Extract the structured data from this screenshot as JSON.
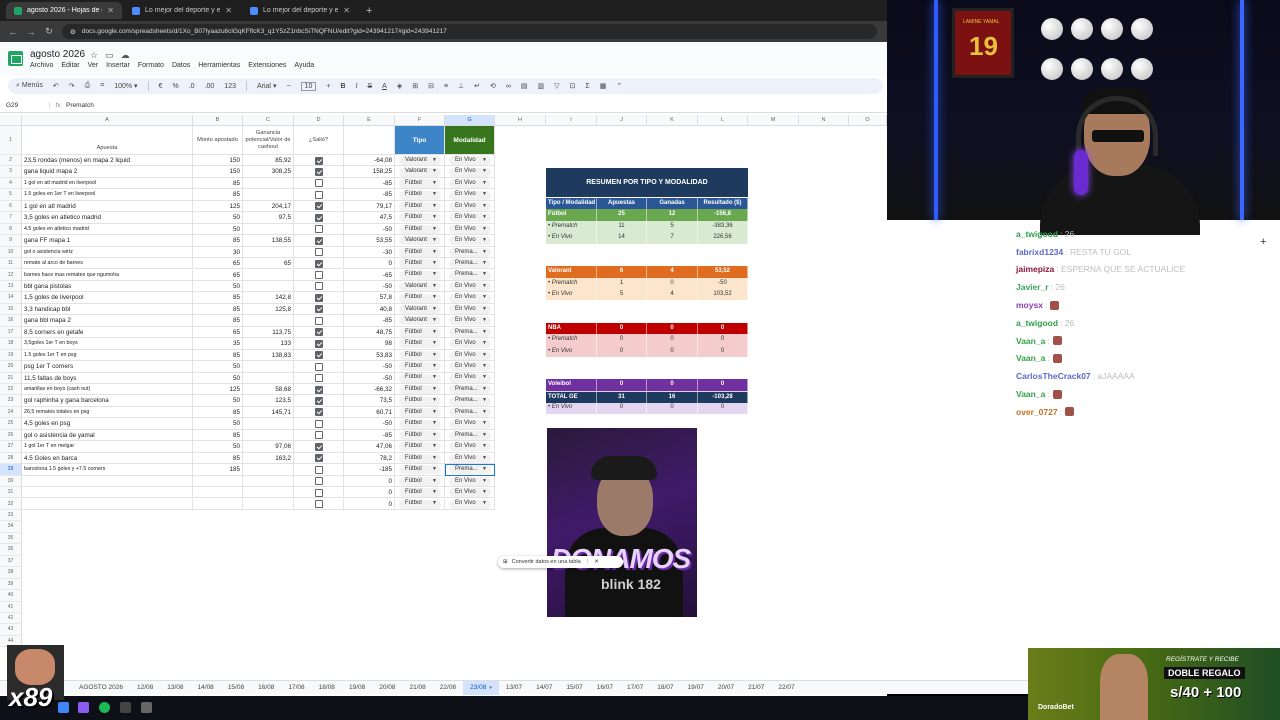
{
  "browser": {
    "tabs": [
      {
        "title": "agosto 2026 - Hojas de cálculo",
        "active": true,
        "favcolor": "#1fa463"
      },
      {
        "title": "Lo mejor del deporte y el entr",
        "active": false,
        "favcolor": "#4c8dff"
      },
      {
        "title": "Lo mejor del deporte y el entr",
        "active": false,
        "favcolor": "#4c8dff"
      }
    ],
    "new_tab": "+",
    "url": "docs.google.com/spreadsheets/d/1Xo_B07lyaazu6clGqKFflcK3_q1Y5zZ1nbcSiTNQFNU/edit?gid=243941217#gid=243941217"
  },
  "doc": {
    "title": "agosto 2026",
    "menu": [
      "Archivo",
      "Editar",
      "Ver",
      "Insertar",
      "Formato",
      "Datos",
      "Herramientas",
      "Extensiones",
      "Ayuda"
    ],
    "toolbar": {
      "menus": "Menús",
      "zoom": "100%",
      "font": "Arial",
      "font_size": "10",
      "format_123": "123"
    },
    "cell_ref": "G29",
    "formula": "Prematch"
  },
  "columns": [
    "A",
    "B",
    "C",
    "D",
    "E",
    "F",
    "G",
    "H",
    "I",
    "J",
    "K",
    "L",
    "M",
    "N",
    "O"
  ],
  "headers": {
    "apuesta": "Apuesta",
    "monto": "Monto apostado",
    "ganancia": "Ganancia potencial/Valor de cashout",
    "salio": "¿Salió?",
    "tipo": "Tipo",
    "modalidad": "Modalidad"
  },
  "row_numbers": [
    "1",
    "2",
    "3",
    "4",
    "5",
    "6",
    "7",
    "8",
    "9",
    "10",
    "11",
    "12",
    "13",
    "14",
    "15",
    "16",
    "17",
    "18",
    "19",
    "20",
    "21",
    "22",
    "23",
    "24",
    "25",
    "26",
    "27",
    "28",
    "29",
    "30",
    "31",
    "32",
    "33",
    "34",
    "35",
    "36",
    "37",
    "38",
    "39",
    "40",
    "41",
    "42",
    "43",
    "44"
  ],
  "rows": [
    {
      "a": "23,5 rondas (menos) en mapa 2 liquid",
      "b": "150",
      "c": "85,92",
      "d": true,
      "e": "-64,08",
      "f": "Valorant",
      "g": "En Vivo"
    },
    {
      "a": "gana liquid mapa 2",
      "b": "150",
      "c": "308,25",
      "d": true,
      "e": "158,25",
      "f": "Valorant",
      "g": "En Vivo"
    },
    {
      "a": "1 gol en atl madrid en liverpool",
      "b": "85",
      "c": "",
      "d": false,
      "e": "-85",
      "f": "Fútbol",
      "g": "En Vivo",
      "small": true
    },
    {
      "a": "1.5 goles en 1er T en liverpool",
      "b": "85",
      "c": "",
      "d": false,
      "e": "-85",
      "f": "Fútbol",
      "g": "En Vivo",
      "small": true
    },
    {
      "a": "1 gol en atl madrid",
      "b": "125",
      "c": "204,17",
      "d": true,
      "e": "79,17",
      "f": "Fútbol",
      "g": "En Vivo"
    },
    {
      "a": "3,5 goles en atletico madrid",
      "b": "50",
      "c": "97,5",
      "d": true,
      "e": "47,5",
      "f": "Fútbol",
      "g": "En Vivo"
    },
    {
      "a": "4.5 goles en atletico madrid",
      "b": "50",
      "c": "",
      "d": false,
      "e": "-50",
      "f": "Fútbol",
      "g": "En Vivo",
      "small": true
    },
    {
      "a": "gana FF mapa 1",
      "b": "85",
      "c": "138,55",
      "d": true,
      "e": "53,55",
      "f": "Valorant",
      "g": "En Vivo"
    },
    {
      "a": "gol o asistencia wirtz",
      "b": "30",
      "c": "",
      "d": false,
      "e": "-30",
      "f": "Fútbol",
      "g": "Prema...",
      "small": true
    },
    {
      "a": "remate al arco de barnes",
      "b": "65",
      "c": "65",
      "d": true,
      "e": "0",
      "f": "Fútbol",
      "g": "Prema...",
      "small": true
    },
    {
      "a": "barnes hace mas remates que ngumoha",
      "b": "65",
      "c": "",
      "d": false,
      "e": "-65",
      "f": "Fútbol",
      "g": "Prema...",
      "small": true
    },
    {
      "a": "bbl gana pistolas",
      "b": "50",
      "c": "",
      "d": false,
      "e": "-50",
      "f": "Valorant",
      "g": "En Vivo"
    },
    {
      "a": "1,5 goles de liverpool",
      "b": "85",
      "c": "142,8",
      "d": true,
      "e": "57,8",
      "f": "Fútbol",
      "g": "En Vivo"
    },
    {
      "a": "3,3 handicap bbl",
      "b": "85",
      "c": "125,8",
      "d": true,
      "e": "40,8",
      "f": "Valorant",
      "g": "En Vivo"
    },
    {
      "a": "gana bbl mapa 2",
      "b": "85",
      "c": "",
      "d": false,
      "e": "-85",
      "f": "Valorant",
      "g": "En Vivo"
    },
    {
      "a": "8,5 corners en getafe",
      "b": "65",
      "c": "113,75",
      "d": true,
      "e": "48,75",
      "f": "Fútbol",
      "g": "Prema..."
    },
    {
      "a": "3,5goles 1er T en boys",
      "b": "35",
      "c": "133",
      "d": true,
      "e": "98",
      "f": "Fútbol",
      "g": "En Vivo",
      "small": true
    },
    {
      "a": "1.5 goles 1er T en psg",
      "b": "85",
      "c": "138,83",
      "d": true,
      "e": "53,83",
      "f": "Fútbol",
      "g": "En Vivo",
      "small": true
    },
    {
      "a": "psg 1er T corners",
      "b": "50",
      "c": "",
      "d": false,
      "e": "-50",
      "f": "Fútbol",
      "g": "En Vivo"
    },
    {
      "a": "11,5 faltas de boys",
      "b": "50",
      "c": "",
      "d": false,
      "e": "-50",
      "f": "Fútbol",
      "g": "En Vivo"
    },
    {
      "a": "amarillas en boys (cash out)",
      "b": "125",
      "c": "58,68",
      "d": true,
      "e": "-66,32",
      "f": "Fútbol",
      "g": "Prema...",
      "small": true
    },
    {
      "a": "gol raphinha y gana barcelona",
      "b": "50",
      "c": "123,5",
      "d": true,
      "e": "73,5",
      "f": "Fútbol",
      "g": "Prema..."
    },
    {
      "a": "26,5 remates totales en psg",
      "b": "85",
      "c": "145,71",
      "d": true,
      "e": "60,71",
      "f": "Fútbol",
      "g": "Prema...",
      "small": true
    },
    {
      "a": "4,5 goles en psg",
      "b": "50",
      "c": "",
      "d": false,
      "e": "-50",
      "f": "Fútbol",
      "g": "En Vivo"
    },
    {
      "a": "gol o asistencia de yamal",
      "b": "85",
      "c": "",
      "d": false,
      "e": "-85",
      "f": "Fútbol",
      "g": "Prema..."
    },
    {
      "a": "1 gol 1er T en melgar",
      "b": "50",
      "c": "97,06",
      "d": true,
      "e": "47,06",
      "f": "Fútbol",
      "g": "En Vivo",
      "small": true
    },
    {
      "a": "4.5 Goles en barca",
      "b": "85",
      "c": "163,2",
      "d": true,
      "e": "78,2",
      "f": "Fútbol",
      "g": "En Vivo"
    },
    {
      "a": "barcelona 1.5 goles y +7.5 corners",
      "b": "185",
      "c": "",
      "d": false,
      "e": "-185",
      "f": "Fútbol",
      "g": "Prema...",
      "small": true
    },
    {
      "a": "",
      "b": "",
      "c": "",
      "d": false,
      "e": "0",
      "f": "Fútbol",
      "g": "En Vivo"
    },
    {
      "a": "",
      "b": "",
      "c": "",
      "d": false,
      "e": "0",
      "f": "Fútbol",
      "g": "En Vivo"
    },
    {
      "a": "",
      "b": "",
      "c": "",
      "d": false,
      "e": "0",
      "f": "Fútbol",
      "g": "En Vivo"
    }
  ],
  "summary": {
    "title": "RESUMEN POR TIPO Y MODALIDAD",
    "headers": [
      "Tipo / Modalidad",
      "Apuestas",
      "Ganadas",
      "Resultado ($)"
    ],
    "groups": [
      {
        "name": "Fútbol",
        "apuestas": "25",
        "ganadas": "12",
        "resultado": "-156,8",
        "color": "#6aa84f",
        "sub_color": "#d9ead3",
        "subs": [
          {
            "name": "• Prematch",
            "apuestas": "11",
            "ganadas": "5",
            "resultado": "-383,36"
          },
          {
            "name": "• En Vivo",
            "apuestas": "14",
            "ganadas": "7",
            "resultado": "226,56"
          }
        ]
      },
      {
        "name": "Valorant",
        "apuestas": "6",
        "ganadas": "4",
        "resultado": "53,52",
        "color": "#e06c1f",
        "sub_color": "#fce5cd",
        "subs": [
          {
            "name": "• Prematch",
            "apuestas": "1",
            "ganadas": "0",
            "resultado": "-50"
          },
          {
            "name": "• En Vivo",
            "apuestas": "5",
            "ganadas": "4",
            "resultado": "103,52"
          }
        ]
      },
      {
        "name": "NBA",
        "apuestas": "0",
        "ganadas": "0",
        "resultado": "0",
        "color": "#c00000",
        "sub_color": "#f4cccc",
        "subs": [
          {
            "name": "• Prematch",
            "apuestas": "0",
            "ganadas": "0",
            "resultado": "0"
          },
          {
            "name": "• En Vivo",
            "apuestas": "0",
            "ganadas": "0",
            "resultado": "0"
          }
        ]
      },
      {
        "name": "Voleibol",
        "apuestas": "0",
        "ganadas": "0",
        "resultado": "0",
        "color": "#7030a0",
        "sub_color": "#e4d6f0",
        "subs": [
          {
            "name": "• Prematch",
            "apuestas": "0",
            "ganadas": "0",
            "resultado": "0"
          },
          {
            "name": "• En Vivo",
            "apuestas": "0",
            "ganadas": "0",
            "resultado": "0"
          }
        ]
      }
    ],
    "total": {
      "name": "TOTAL GE",
      "apuestas": "31",
      "ganadas": "16",
      "resultado": "-103,28"
    }
  },
  "video_card": {
    "big": "DONAMOS",
    "small": "blink 182"
  },
  "toast": {
    "text": "Convertir datos en una tabla"
  },
  "sheet_tabs": [
    "AGOSTO 2026",
    "12/08",
    "13/08",
    "14/08",
    "15/08",
    "16/08",
    "17/08",
    "18/08",
    "19/08",
    "20/08",
    "21/08",
    "22/08",
    "23/08",
    "13/07",
    "14/07",
    "15/07",
    "16/07",
    "17/07",
    "18/07",
    "19/07",
    "20/07",
    "21/07",
    "22/07"
  ],
  "active_sheet": "23/08",
  "webcam": {
    "jersey_number": "19",
    "jersey_name": "LAMINE YAMAL"
  },
  "chat": [
    {
      "user": "a_twigood",
      "text": ": 26",
      "color": "#2e9e4a"
    },
    {
      "user": "fabrixd1234",
      "text": ": RESTA TU GOL",
      "color": "#5a6ac8"
    },
    {
      "user": "jaimepiza",
      "text": ": ESPERNA QUE SE ACTUALICE",
      "color": "#8a1538"
    },
    {
      "user": "Javier_r",
      "text": ": 26",
      "color": "#3aa35a"
    },
    {
      "user": "moysx",
      "text": ":",
      "color": "#8a3fb5",
      "emote": true
    },
    {
      "user": "a_twigood",
      "text": ": 26",
      "color": "#2e9e4a"
    },
    {
      "user": "Vaan_a",
      "text": ":",
      "color": "#35a345",
      "emote": true
    },
    {
      "user": "Vaan_a",
      "text": ":",
      "color": "#35a345",
      "emote": true
    },
    {
      "user": "CarlosTheCrack07",
      "text": ": aJAAAAA",
      "color": "#5a6ac8"
    },
    {
      "user": "Vaan_a",
      "text": ":",
      "color": "#35a345",
      "emote": true
    },
    {
      "user": "over_0727",
      "text": ":",
      "color": "#c07020",
      "emote": true
    }
  ],
  "overlay": {
    "multiplier": "x89"
  },
  "ad": {
    "line1": "REGÍSTRATE Y RECIBE",
    "line2": "DOBLE REGALO",
    "line3": "s/40 + 100",
    "brand": "DoradoBet"
  }
}
